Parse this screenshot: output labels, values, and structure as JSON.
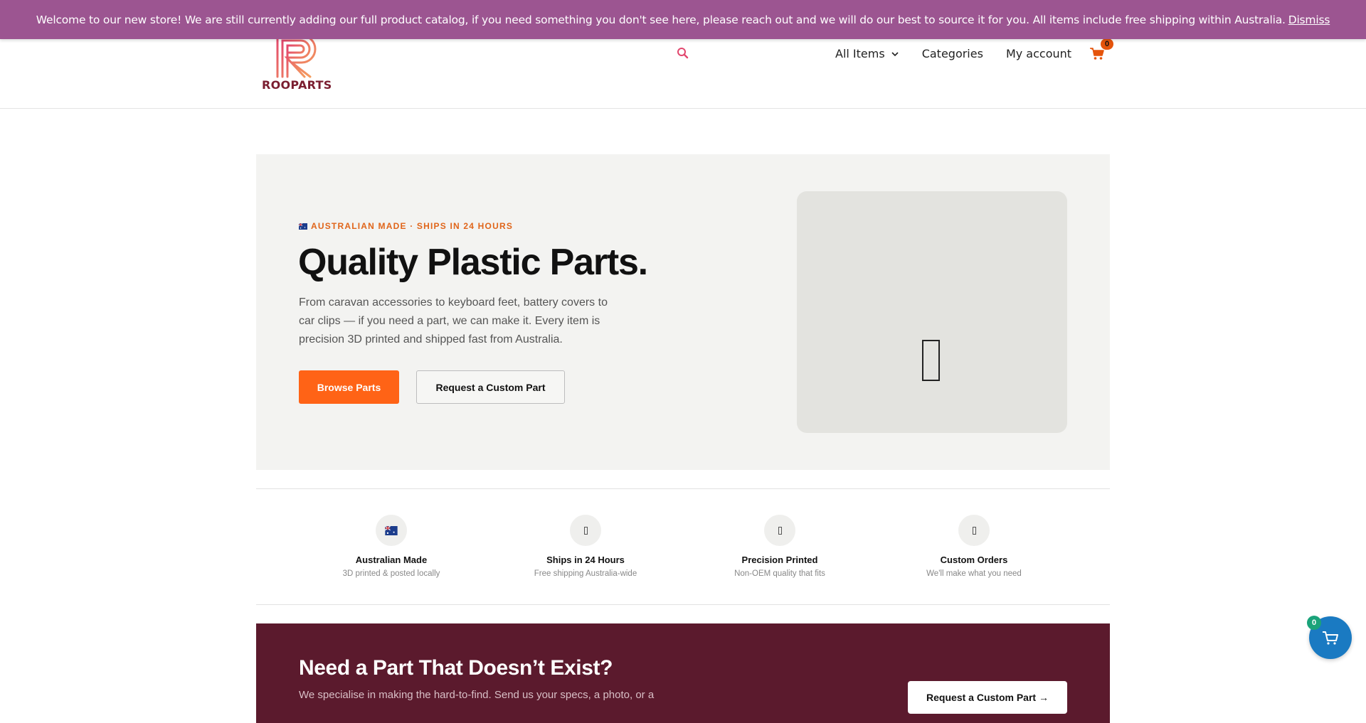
{
  "notice": {
    "message": "Welcome to our new store! We are still currently adding our full product catalog, if you need something you don't see here, please reach out and we will do our best to source it for you. All items include free shipping within Australia.",
    "dismiss_label": "Dismiss"
  },
  "header": {
    "logo_text": "ROOPARTS",
    "nav": {
      "all_items": "All Items",
      "categories": "Categories",
      "my_account": "My account"
    },
    "cart_count": "0"
  },
  "hero": {
    "eyebrow": "AUSTRALIAN MADE · SHIPS IN 24 HOURS",
    "title": "Quality Plastic Parts.",
    "description": "From caravan accessories to keyboard feet, battery covers to car clips — if you need a part, we can make it. Every item is precision 3D printed and shipped fast from Australia.",
    "primary_button": "Browse Parts",
    "secondary_button": "Request a Custom Part"
  },
  "features": [
    {
      "title": "Australian Made",
      "subtitle": "3D printed & posted locally"
    },
    {
      "title": "Ships in 24 Hours",
      "subtitle": "Free shipping Australia-wide"
    },
    {
      "title": "Precision Printed",
      "subtitle": "Non-OEM quality that fits"
    },
    {
      "title": "Custom Orders",
      "subtitle": "We'll make what you need"
    }
  ],
  "cta": {
    "title": "Need a Part That Doesn’t Exist?",
    "description": "We specialise in making the hard-to-find. Send us your specs, a photo, or a",
    "button": "Request a Custom Part →"
  },
  "floating_cart": {
    "count": "0"
  },
  "colors": {
    "notice_bg": "#9c5591",
    "accent_orange": "#ff6316",
    "cta_bg": "#5b1a2d",
    "fab_blue": "#1a7ac2",
    "fab_badge_green": "#1aa37a"
  }
}
